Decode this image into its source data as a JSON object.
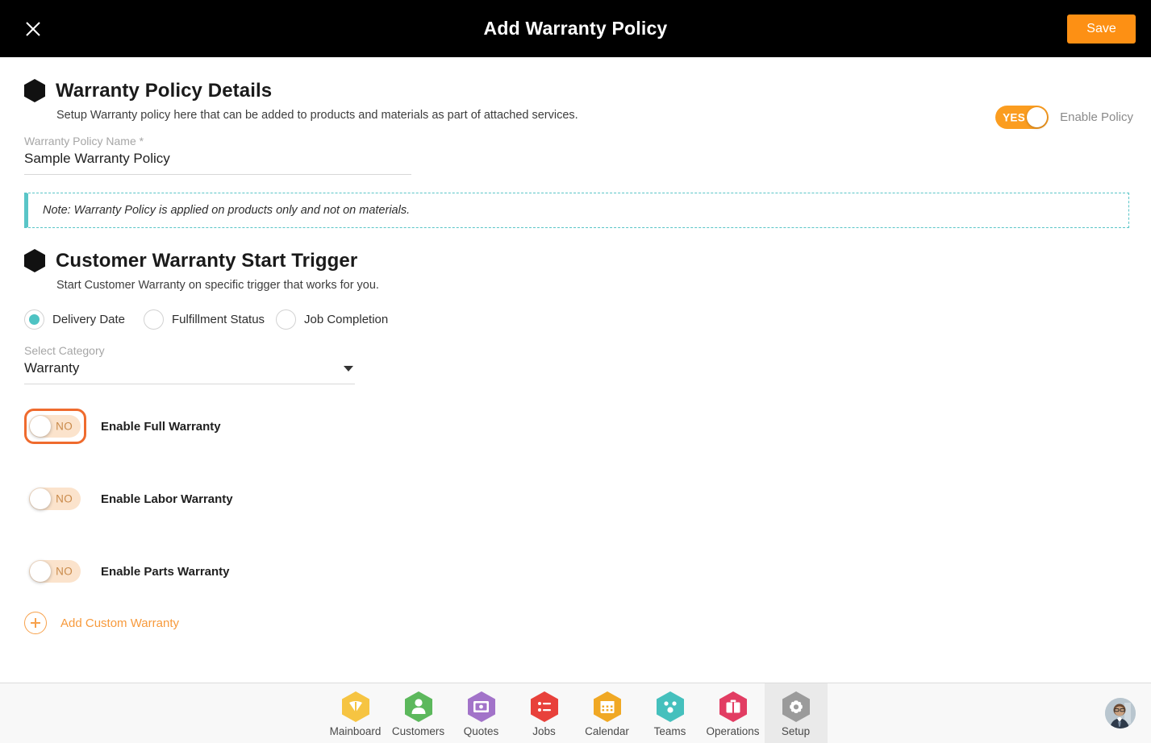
{
  "topbar": {
    "close_icon": "close-icon",
    "title": "Add Warranty Policy",
    "save_label": "Save"
  },
  "policy_details": {
    "title": "Warranty Policy Details",
    "subtitle": "Setup Warranty policy here that can be added to products and materials as part of attached services.",
    "name_field": {
      "label": "Warranty Policy Name *",
      "value": "Sample Warranty Policy",
      "placeholder": "Warranty Policy Name"
    },
    "enable_policy": {
      "state_label": "YES",
      "label": "Enable Policy",
      "checked": true,
      "color": "#fb9d20"
    }
  },
  "note": {
    "text": "Note: Warranty Policy is applied on products only and not on materials.",
    "accent_color": "#59c5c7"
  },
  "start_trigger": {
    "title": "Customer Warranty Start Trigger",
    "subtitle": "Start Customer Warranty on specific trigger that works for you.",
    "options": [
      {
        "label": "Delivery Date",
        "selected": true
      },
      {
        "label": "Fulfillment Status",
        "selected": false
      },
      {
        "label": "Job Completion",
        "selected": false
      }
    ],
    "selected_color": "#4ec3c3",
    "category": {
      "label": "Select Category",
      "value": "Warranty",
      "caret_icon": "chevron-down-icon"
    }
  },
  "warranty_toggles": [
    {
      "state_label": "NO",
      "label": "Enable Full Warranty",
      "checked": false,
      "focused": true
    },
    {
      "state_label": "NO",
      "label": "Enable Labor Warranty",
      "checked": false,
      "focused": false
    },
    {
      "state_label": "NO",
      "label": "Enable Parts Warranty",
      "checked": false,
      "focused": false
    }
  ],
  "add_custom": {
    "icon": "plus-circle-icon",
    "label": "Add Custom Warranty",
    "color": "#f79a3c"
  },
  "bottom_nav": {
    "items": [
      {
        "label": "Mainboard",
        "icon": "mainboard-icon",
        "color": "#f6c442",
        "active": false
      },
      {
        "label": "Customers",
        "icon": "customers-icon",
        "color": "#5cb85c",
        "active": false
      },
      {
        "label": "Quotes",
        "icon": "quotes-icon",
        "color": "#a273c9",
        "active": false
      },
      {
        "label": "Jobs",
        "icon": "jobs-icon",
        "color": "#e8413b",
        "active": false
      },
      {
        "label": "Calendar",
        "icon": "calendar-icon",
        "color": "#f0a824",
        "active": false
      },
      {
        "label": "Teams",
        "icon": "teams-icon",
        "color": "#45c0bd",
        "active": false
      },
      {
        "label": "Operations",
        "icon": "operations-icon",
        "color": "#e23d63",
        "active": false
      },
      {
        "label": "Setup",
        "icon": "setup-gear-icon",
        "color": "#9b9b9b",
        "active": true
      }
    ],
    "avatar": "user-avatar"
  },
  "focus_ring_color": "#ef6b2e"
}
